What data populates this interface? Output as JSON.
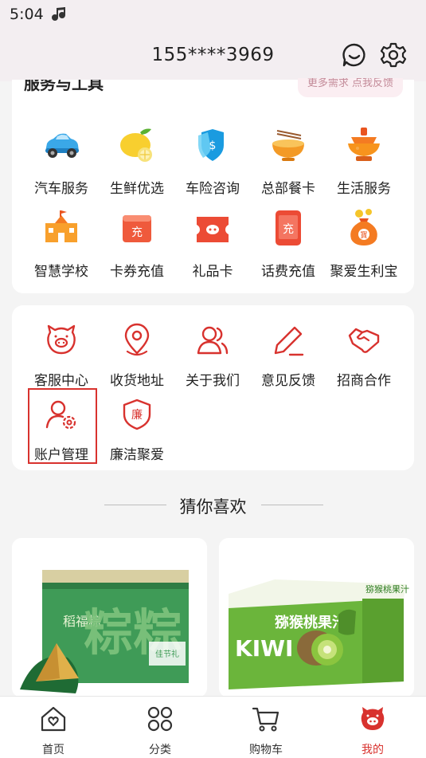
{
  "status_bar": {
    "time": "5:04"
  },
  "header": {
    "phone": "155****3969"
  },
  "services": {
    "title": "服务与工具",
    "feedback_link": "更多需求 点我反馈",
    "items": [
      {
        "label": "汽车服务",
        "icon": "car-icon"
      },
      {
        "label": "生鲜优选",
        "icon": "lemon-icon"
      },
      {
        "label": "车险咨询",
        "icon": "shield-icon"
      },
      {
        "label": "总部餐卡",
        "icon": "noodle-bowl-icon"
      },
      {
        "label": "生活服务",
        "icon": "hotpot-icon"
      },
      {
        "label": "智慧学校",
        "icon": "school-icon"
      },
      {
        "label": "卡券充值",
        "icon": "coupon-recharge-icon"
      },
      {
        "label": "礼品卡",
        "icon": "gift-card-icon"
      },
      {
        "label": "话费充值",
        "icon": "phone-recharge-icon"
      },
      {
        "label": "聚爱生利宝",
        "icon": "treasure-bag-icon"
      }
    ]
  },
  "more": {
    "items": [
      {
        "label": "客服中心",
        "icon": "pig-service-icon"
      },
      {
        "label": "收货地址",
        "icon": "location-pin-icon"
      },
      {
        "label": "关于我们",
        "icon": "people-icon"
      },
      {
        "label": "意见反馈",
        "icon": "pencil-icon"
      },
      {
        "label": "招商合作",
        "icon": "handshake-icon"
      },
      {
        "label": "账户管理",
        "icon": "user-settings-icon"
      },
      {
        "label": "廉洁聚爱",
        "icon": "integrity-shield-icon",
        "icon_text": "廉"
      }
    ]
  },
  "recommend": {
    "title": "猜你喜欢",
    "products": [
      {
        "label_main": "粽粽",
        "label_left": "稻福粽",
        "label_tag": "佳节礼"
      },
      {
        "label_top": "猕猴桃果汁",
        "label_kiwi": "KIWI",
        "label_right": "猕猴桃果汁"
      }
    ]
  },
  "tabbar": {
    "tabs": [
      {
        "label": "首页",
        "icon": "home-icon"
      },
      {
        "label": "分类",
        "icon": "category-icon"
      },
      {
        "label": "购物车",
        "icon": "cart-icon"
      },
      {
        "label": "我的",
        "icon": "pig-profile-icon",
        "active": true
      }
    ]
  },
  "colors": {
    "accent": "#d8322e",
    "link": "#c38b99"
  }
}
